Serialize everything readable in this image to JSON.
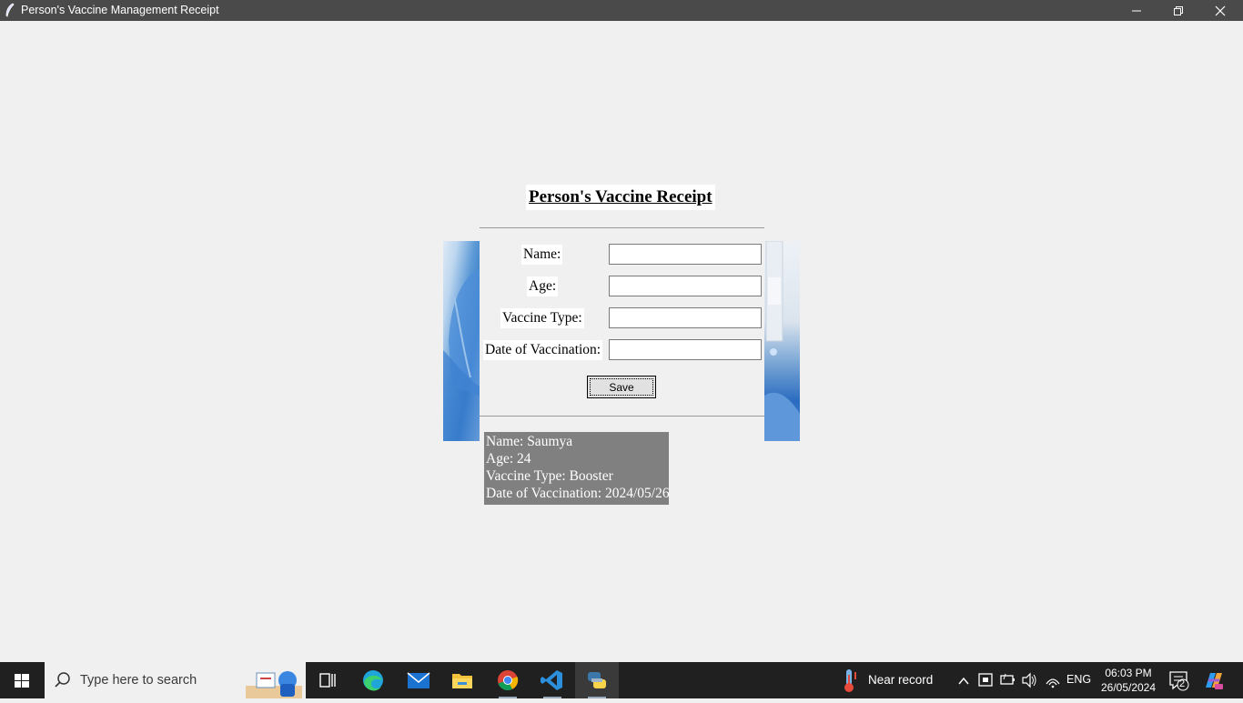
{
  "window": {
    "title": "Person's Vaccine Management Receipt"
  },
  "form": {
    "heading": "Person's Vaccine Receipt",
    "labels": {
      "name": "Name:",
      "age": "Age:",
      "vaccine_type": "Vaccine Type:",
      "date": "Date of Vaccination:"
    },
    "values": {
      "name": "",
      "age": "",
      "vaccine_type": "",
      "date": ""
    },
    "save_label": "Save"
  },
  "receipt": {
    "lines": [
      "Name: Saumya",
      "Age: 24",
      "Vaccine Type: Booster",
      "Date of Vaccination: 2024/05/26"
    ]
  },
  "taskbar": {
    "search_placeholder": "Type here to search",
    "weather_text": "Near record",
    "language": "ENG",
    "time": "06:03 PM",
    "date": "26/05/2024",
    "notification_count": "2"
  },
  "colors": {
    "titlebar": "#4a4a4a",
    "window_bg": "#f0f0f0",
    "receipt_bg": "#808080",
    "taskbar": "#202020"
  }
}
